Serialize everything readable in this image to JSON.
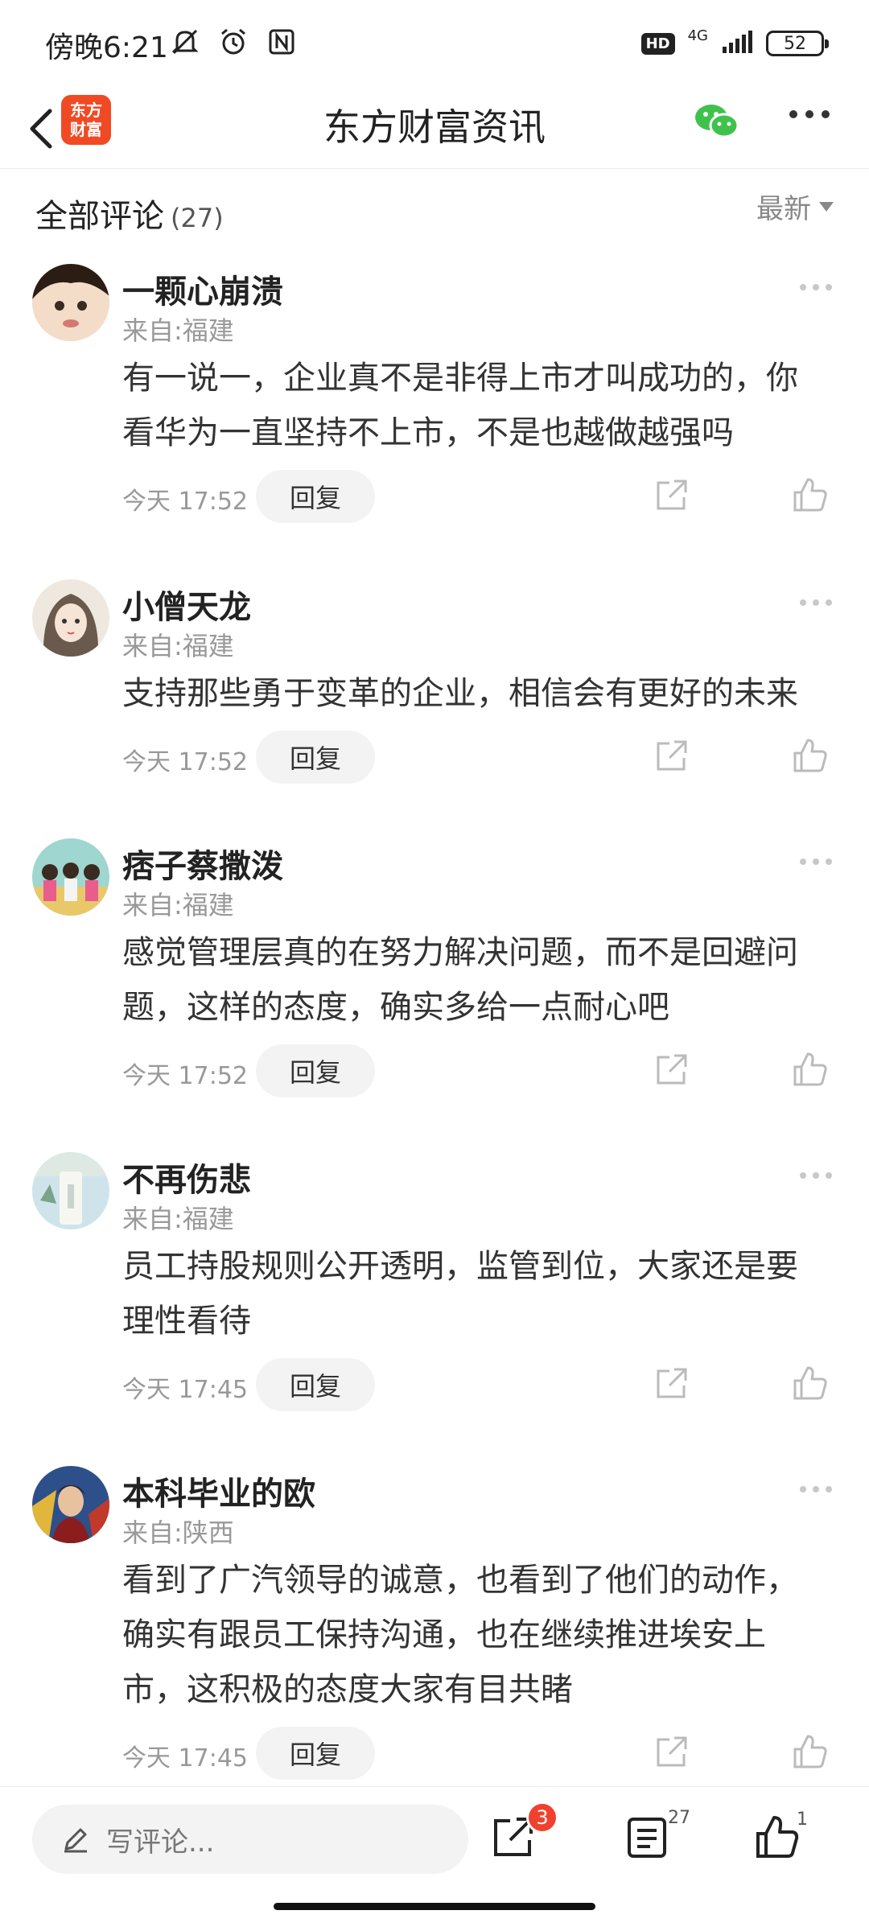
{
  "status_bar": {
    "time": "傍晚6:21",
    "hd": "HD",
    "network": "4G",
    "battery": "52"
  },
  "header": {
    "logo_text": "东方\n财富",
    "title": "东方财富资讯"
  },
  "comments_header": {
    "title": "全部评论",
    "count": "(27)",
    "sort_label": "最新"
  },
  "comments": [
    {
      "name": "一颗心崩溃",
      "location": "来自:福建",
      "text": "有一说一，企业真不是非得上市才叫成功的，你看华为一直坚持不上市，不是也越做越强吗",
      "time": "今天 17:52",
      "reply_label": "回复"
    },
    {
      "name": "小僧天龙",
      "location": "来自:福建",
      "text": "支持那些勇于变革的企业，相信会有更好的未来",
      "time": "今天 17:52",
      "reply_label": "回复"
    },
    {
      "name": "痞子蔡撒泼",
      "location": "来自:福建",
      "text": "感觉管理层真的在努力解决问题，而不是回避问题，这样的态度，确实多给一点耐心吧",
      "time": "今天 17:52",
      "reply_label": "回复"
    },
    {
      "name": "不再伤悲",
      "location": "来自:福建",
      "text": "员工持股规则公开透明，监管到位，大家还是要理性看待",
      "time": "今天 17:45",
      "reply_label": "回复"
    },
    {
      "name": "本科毕业的欧",
      "location": "来自:陕西",
      "text": "看到了广汽领导的诚意，也看到了他们的动作，确实有跟员工保持沟通，也在继续推进埃安上市，这积极的态度大家有目共睹",
      "time": "今天 17:45",
      "reply_label": "回复"
    }
  ],
  "bottom_bar": {
    "placeholder": "写评论...",
    "share_badge": "3",
    "comment_count": "27",
    "like_count": "1"
  },
  "colors": {
    "accent": "#f04a24",
    "badge": "#f0412f",
    "wechat": "#3fc24b"
  }
}
